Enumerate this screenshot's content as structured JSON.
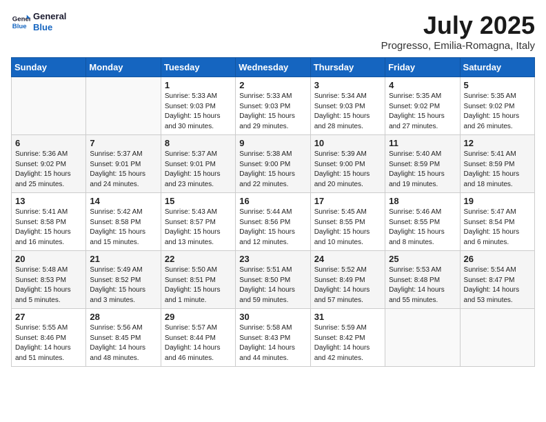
{
  "header": {
    "logo_line1": "General",
    "logo_line2": "Blue",
    "month_year": "July 2025",
    "location": "Progresso, Emilia-Romagna, Italy"
  },
  "weekdays": [
    "Sunday",
    "Monday",
    "Tuesday",
    "Wednesday",
    "Thursday",
    "Friday",
    "Saturday"
  ],
  "weeks": [
    [
      {
        "day": "",
        "sunrise": "",
        "sunset": "",
        "daylight": ""
      },
      {
        "day": "",
        "sunrise": "",
        "sunset": "",
        "daylight": ""
      },
      {
        "day": "1",
        "sunrise": "Sunrise: 5:33 AM",
        "sunset": "Sunset: 9:03 PM",
        "daylight": "Daylight: 15 hours and 30 minutes."
      },
      {
        "day": "2",
        "sunrise": "Sunrise: 5:33 AM",
        "sunset": "Sunset: 9:03 PM",
        "daylight": "Daylight: 15 hours and 29 minutes."
      },
      {
        "day": "3",
        "sunrise": "Sunrise: 5:34 AM",
        "sunset": "Sunset: 9:03 PM",
        "daylight": "Daylight: 15 hours and 28 minutes."
      },
      {
        "day": "4",
        "sunrise": "Sunrise: 5:35 AM",
        "sunset": "Sunset: 9:02 PM",
        "daylight": "Daylight: 15 hours and 27 minutes."
      },
      {
        "day": "5",
        "sunrise": "Sunrise: 5:35 AM",
        "sunset": "Sunset: 9:02 PM",
        "daylight": "Daylight: 15 hours and 26 minutes."
      }
    ],
    [
      {
        "day": "6",
        "sunrise": "Sunrise: 5:36 AM",
        "sunset": "Sunset: 9:02 PM",
        "daylight": "Daylight: 15 hours and 25 minutes."
      },
      {
        "day": "7",
        "sunrise": "Sunrise: 5:37 AM",
        "sunset": "Sunset: 9:01 PM",
        "daylight": "Daylight: 15 hours and 24 minutes."
      },
      {
        "day": "8",
        "sunrise": "Sunrise: 5:37 AM",
        "sunset": "Sunset: 9:01 PM",
        "daylight": "Daylight: 15 hours and 23 minutes."
      },
      {
        "day": "9",
        "sunrise": "Sunrise: 5:38 AM",
        "sunset": "Sunset: 9:00 PM",
        "daylight": "Daylight: 15 hours and 22 minutes."
      },
      {
        "day": "10",
        "sunrise": "Sunrise: 5:39 AM",
        "sunset": "Sunset: 9:00 PM",
        "daylight": "Daylight: 15 hours and 20 minutes."
      },
      {
        "day": "11",
        "sunrise": "Sunrise: 5:40 AM",
        "sunset": "Sunset: 8:59 PM",
        "daylight": "Daylight: 15 hours and 19 minutes."
      },
      {
        "day": "12",
        "sunrise": "Sunrise: 5:41 AM",
        "sunset": "Sunset: 8:59 PM",
        "daylight": "Daylight: 15 hours and 18 minutes."
      }
    ],
    [
      {
        "day": "13",
        "sunrise": "Sunrise: 5:41 AM",
        "sunset": "Sunset: 8:58 PM",
        "daylight": "Daylight: 15 hours and 16 minutes."
      },
      {
        "day": "14",
        "sunrise": "Sunrise: 5:42 AM",
        "sunset": "Sunset: 8:58 PM",
        "daylight": "Daylight: 15 hours and 15 minutes."
      },
      {
        "day": "15",
        "sunrise": "Sunrise: 5:43 AM",
        "sunset": "Sunset: 8:57 PM",
        "daylight": "Daylight: 15 hours and 13 minutes."
      },
      {
        "day": "16",
        "sunrise": "Sunrise: 5:44 AM",
        "sunset": "Sunset: 8:56 PM",
        "daylight": "Daylight: 15 hours and 12 minutes."
      },
      {
        "day": "17",
        "sunrise": "Sunrise: 5:45 AM",
        "sunset": "Sunset: 8:55 PM",
        "daylight": "Daylight: 15 hours and 10 minutes."
      },
      {
        "day": "18",
        "sunrise": "Sunrise: 5:46 AM",
        "sunset": "Sunset: 8:55 PM",
        "daylight": "Daylight: 15 hours and 8 minutes."
      },
      {
        "day": "19",
        "sunrise": "Sunrise: 5:47 AM",
        "sunset": "Sunset: 8:54 PM",
        "daylight": "Daylight: 15 hours and 6 minutes."
      }
    ],
    [
      {
        "day": "20",
        "sunrise": "Sunrise: 5:48 AM",
        "sunset": "Sunset: 8:53 PM",
        "daylight": "Daylight: 15 hours and 5 minutes."
      },
      {
        "day": "21",
        "sunrise": "Sunrise: 5:49 AM",
        "sunset": "Sunset: 8:52 PM",
        "daylight": "Daylight: 15 hours and 3 minutes."
      },
      {
        "day": "22",
        "sunrise": "Sunrise: 5:50 AM",
        "sunset": "Sunset: 8:51 PM",
        "daylight": "Daylight: 15 hours and 1 minute."
      },
      {
        "day": "23",
        "sunrise": "Sunrise: 5:51 AM",
        "sunset": "Sunset: 8:50 PM",
        "daylight": "Daylight: 14 hours and 59 minutes."
      },
      {
        "day": "24",
        "sunrise": "Sunrise: 5:52 AM",
        "sunset": "Sunset: 8:49 PM",
        "daylight": "Daylight: 14 hours and 57 minutes."
      },
      {
        "day": "25",
        "sunrise": "Sunrise: 5:53 AM",
        "sunset": "Sunset: 8:48 PM",
        "daylight": "Daylight: 14 hours and 55 minutes."
      },
      {
        "day": "26",
        "sunrise": "Sunrise: 5:54 AM",
        "sunset": "Sunset: 8:47 PM",
        "daylight": "Daylight: 14 hours and 53 minutes."
      }
    ],
    [
      {
        "day": "27",
        "sunrise": "Sunrise: 5:55 AM",
        "sunset": "Sunset: 8:46 PM",
        "daylight": "Daylight: 14 hours and 51 minutes."
      },
      {
        "day": "28",
        "sunrise": "Sunrise: 5:56 AM",
        "sunset": "Sunset: 8:45 PM",
        "daylight": "Daylight: 14 hours and 48 minutes."
      },
      {
        "day": "29",
        "sunrise": "Sunrise: 5:57 AM",
        "sunset": "Sunset: 8:44 PM",
        "daylight": "Daylight: 14 hours and 46 minutes."
      },
      {
        "day": "30",
        "sunrise": "Sunrise: 5:58 AM",
        "sunset": "Sunset: 8:43 PM",
        "daylight": "Daylight: 14 hours and 44 minutes."
      },
      {
        "day": "31",
        "sunrise": "Sunrise: 5:59 AM",
        "sunset": "Sunset: 8:42 PM",
        "daylight": "Daylight: 14 hours and 42 minutes."
      },
      {
        "day": "",
        "sunrise": "",
        "sunset": "",
        "daylight": ""
      },
      {
        "day": "",
        "sunrise": "",
        "sunset": "",
        "daylight": ""
      }
    ]
  ]
}
